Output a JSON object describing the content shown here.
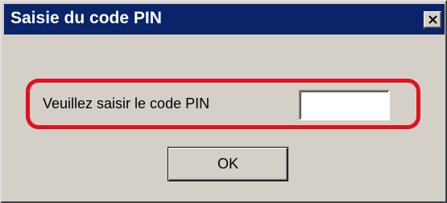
{
  "window": {
    "title": "Saisie du code PIN",
    "close_icon": "close-x-icon"
  },
  "form": {
    "prompt_label": "Veuillez saisir le code PIN",
    "pin_value": "",
    "highlight_color": "#e2111d"
  },
  "buttons": {
    "ok_label": "OK"
  },
  "colors": {
    "titlebar": "#0a246a",
    "dialog_face": "#d4d0c8"
  }
}
